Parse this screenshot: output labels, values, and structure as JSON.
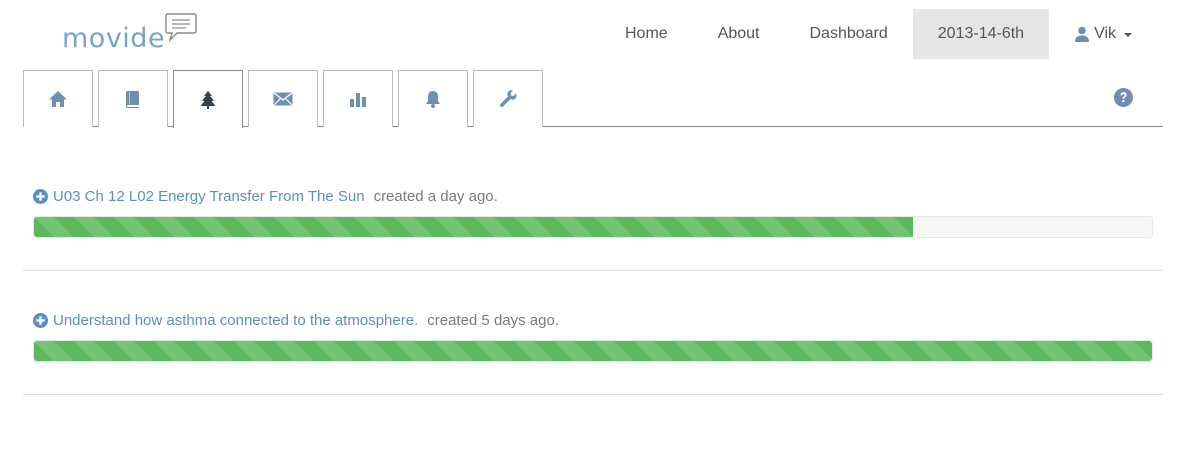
{
  "brand": {
    "name": "movide",
    "color": "#7aa3c6"
  },
  "topnav": {
    "items": [
      {
        "label": "Home"
      },
      {
        "label": "About"
      },
      {
        "label": "Dashboard"
      },
      {
        "label": "2013-14-6th"
      }
    ],
    "user": {
      "label": "Vik",
      "icon": "user-icon"
    }
  },
  "tabs": [
    {
      "icon": "home-icon"
    },
    {
      "icon": "book-icon"
    },
    {
      "icon": "tree-icon",
      "active": true
    },
    {
      "icon": "envelope-icon"
    },
    {
      "icon": "bar-chart-icon"
    },
    {
      "icon": "bell-icon"
    },
    {
      "icon": "wrench-icon"
    }
  ],
  "help": {
    "icon": "question-icon"
  },
  "items": [
    {
      "title": "U03 Ch 12 L02 Energy Transfer From The Sun",
      "meta": "created a day ago.",
      "progress": 0.786
    },
    {
      "title": "Understand how asthma connected to the atmosphere.",
      "meta": "created 5 days ago.",
      "progress": 1.0
    }
  ],
  "colors": {
    "accent": "#5b8fc0",
    "success": "#5cb85c",
    "icon": "#6f8fb0",
    "active_nav_bg": "#e5e5e5"
  }
}
